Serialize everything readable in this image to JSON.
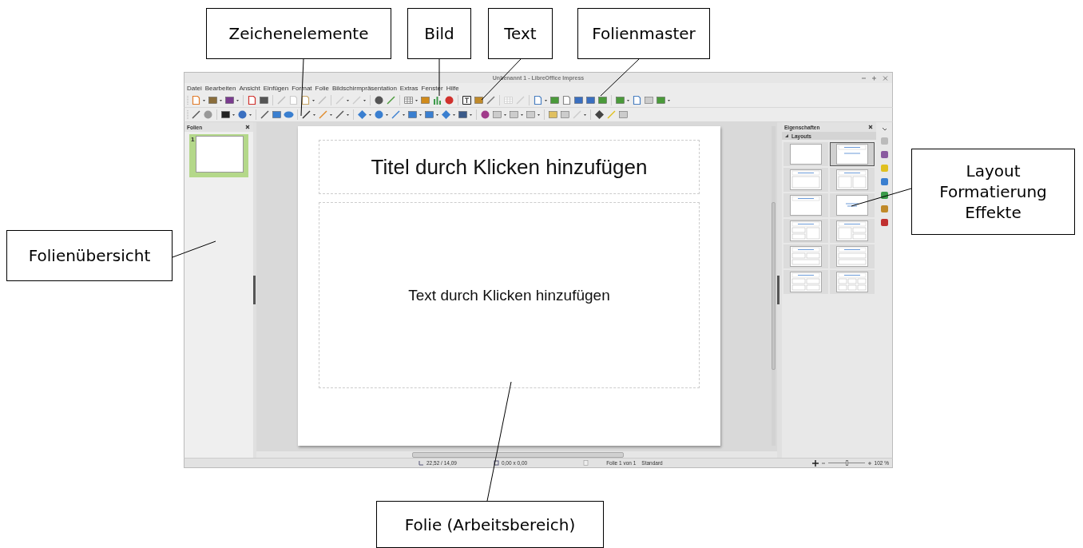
{
  "window": {
    "title": "Unbenannt 1 - LibreOffice Impress"
  },
  "menu": [
    "Datei",
    "Bearbeiten",
    "Ansicht",
    "Einfügen",
    "Format",
    "Folie",
    "Bildschirmpräsentation",
    "Extras",
    "Fenster",
    "Hilfe"
  ],
  "slides_panel": {
    "title": "Folien",
    "slides": [
      {
        "number": "1",
        "selected": true
      }
    ]
  },
  "slide": {
    "title_placeholder": "Titel durch Klicken hinzufügen",
    "body_placeholder": "Text durch Klicken hinzufügen"
  },
  "sidebar": {
    "title": "Eigenschaften",
    "section": "Layouts",
    "expanded": true,
    "layouts": [
      {
        "kind": "blank",
        "selected": false
      },
      {
        "kind": "titleslide",
        "selected": true
      },
      {
        "kind": "content",
        "selected": false
      },
      {
        "kind": "twocontent",
        "selected": false
      },
      {
        "kind": "titleonly",
        "selected": false
      },
      {
        "kind": "centered",
        "selected": false
      },
      {
        "kind": "stackedleft",
        "selected": false
      },
      {
        "kind": "stackedright",
        "selected": false
      },
      {
        "kind": "splittop",
        "selected": false
      },
      {
        "kind": "stacked",
        "selected": false
      },
      {
        "kind": "quad",
        "selected": false
      },
      {
        "kind": "six",
        "selected": false
      }
    ]
  },
  "status_bar": {
    "position": "22,52 / 14,09",
    "size": "0,00 x 0,00",
    "slide": "Folie 1 von 1",
    "master": "Standard",
    "zoom": {
      "level": 0.5
    },
    "zoom_reading": "102 %"
  },
  "callouts": [
    {
      "text": "Zeichenelemente"
    },
    {
      "text": "Bild"
    },
    {
      "text": "Text"
    },
    {
      "text": "Folienmaster"
    },
    {
      "text": "Layout\nFormatierung\nEffekte"
    },
    {
      "text": "Folienübersicht"
    },
    {
      "text": "Folie (Arbeitsbereich)"
    }
  ]
}
